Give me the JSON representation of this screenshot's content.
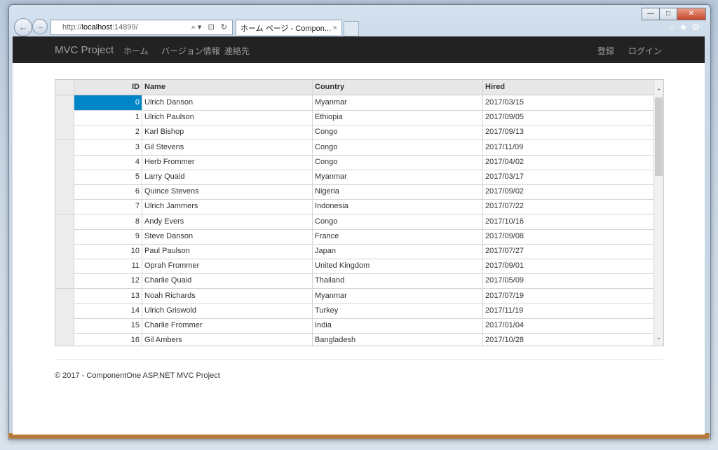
{
  "browser": {
    "url_prefix": "http://",
    "url_host": "localhost",
    "url_suffix": ":14899/",
    "address_tools": "⌕▾ ⊡ ↻",
    "tab_title": "ホーム ページ - Compon...",
    "tab_close": "×",
    "back_glyph": "←",
    "forward_glyph": "→",
    "right_icons": "⌂★⚙"
  },
  "window_controls": {
    "minimize": "—",
    "maximize": "□",
    "close": "✕"
  },
  "navbar": {
    "brand": "MVC Project",
    "links": [
      "ホーム",
      "バージョン情報",
      "連絡先"
    ],
    "right_links": [
      "登録",
      "ログイン"
    ]
  },
  "grid": {
    "headers": {
      "id": "ID",
      "name": "Name",
      "country": "Country",
      "hired": "Hired"
    },
    "rows": [
      {
        "id": "0",
        "name": "Ulrich Danson",
        "country": "Myanmar",
        "hired": "2017/03/15"
      },
      {
        "id": "1",
        "name": "Ulrich Paulson",
        "country": "Ethiopia",
        "hired": "2017/09/05"
      },
      {
        "id": "2",
        "name": "Karl Bishop",
        "country": "Congo",
        "hired": "2017/09/13"
      },
      {
        "id": "3",
        "name": "Gil Stevens",
        "country": "Congo",
        "hired": "2017/11/09"
      },
      {
        "id": "4",
        "name": "Herb Frommer",
        "country": "Congo",
        "hired": "2017/04/02"
      },
      {
        "id": "5",
        "name": "Larry Quaid",
        "country": "Myanmar",
        "hired": "2017/03/17"
      },
      {
        "id": "6",
        "name": "Quince Stevens",
        "country": "Nigeria",
        "hired": "2017/09/02"
      },
      {
        "id": "7",
        "name": "Ulrich Jammers",
        "country": "Indonesia",
        "hired": "2017/07/22"
      },
      {
        "id": "8",
        "name": "Andy Evers",
        "country": "Congo",
        "hired": "2017/10/16"
      },
      {
        "id": "9",
        "name": "Steve Danson",
        "country": "France",
        "hired": "2017/09/08"
      },
      {
        "id": "10",
        "name": "Paul Paulson",
        "country": "Japan",
        "hired": "2017/07/27"
      },
      {
        "id": "11",
        "name": "Oprah Frommer",
        "country": "United Kingdom",
        "hired": "2017/09/01"
      },
      {
        "id": "12",
        "name": "Charlie Quaid",
        "country": "Thailand",
        "hired": "2017/05/09"
      },
      {
        "id": "13",
        "name": "Noah Richards",
        "country": "Myanmar",
        "hired": "2017/07/19"
      },
      {
        "id": "14",
        "name": "Ulrich Griswold",
        "country": "Turkey",
        "hired": "2017/11/19"
      },
      {
        "id": "15",
        "name": "Charlie Frommer",
        "country": "India",
        "hired": "2017/01/04"
      },
      {
        "id": "16",
        "name": "Gil Ambers",
        "country": "Bangladesh",
        "hired": "2017/10/28"
      }
    ],
    "selected_id": "0",
    "scroll_up": "⌃",
    "scroll_down": "⌄"
  },
  "footer": {
    "text": "© 2017 - ComponentOne ASP.NET MVC Project"
  },
  "colors": {
    "navbar_bg": "#222222",
    "selection": "#0085c7"
  }
}
